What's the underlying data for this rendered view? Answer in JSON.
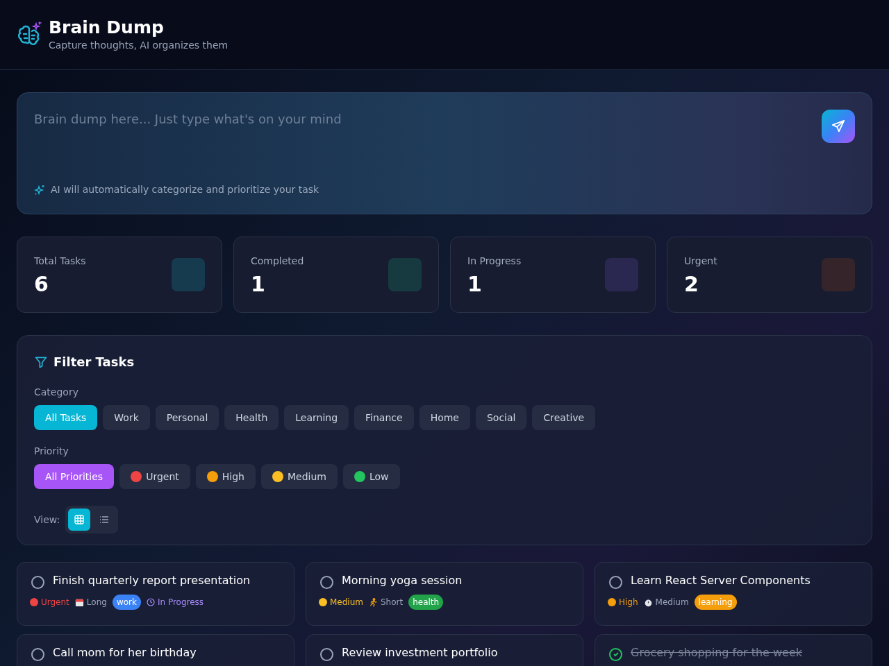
{
  "header": {
    "title": "Brain Dump",
    "subtitle": "Capture thoughts, AI organizes them"
  },
  "input": {
    "placeholder": "Brain dump here... Just type what's on your mind",
    "hint": "AI will automatically categorize and prioritize your task"
  },
  "stats": [
    {
      "label": "Total Tasks",
      "value": "6",
      "color": "#163a4e"
    },
    {
      "label": "Completed",
      "value": "1",
      "color": "#173a40"
    },
    {
      "label": "In Progress",
      "value": "1",
      "color": "#2a2850"
    },
    {
      "label": "Urgent",
      "value": "2",
      "color": "#35252a"
    }
  ],
  "filter": {
    "title": "Filter Tasks",
    "category_label": "Category",
    "categories": [
      {
        "label": "All Tasks",
        "selected": true
      },
      {
        "label": "Work",
        "selected": false
      },
      {
        "label": "Personal",
        "selected": false
      },
      {
        "label": "Health",
        "selected": false
      },
      {
        "label": "Learning",
        "selected": false
      },
      {
        "label": "Finance",
        "selected": false
      },
      {
        "label": "Home",
        "selected": false
      },
      {
        "label": "Social",
        "selected": false
      },
      {
        "label": "Creative",
        "selected": false
      }
    ],
    "priority_label": "Priority",
    "priorities": [
      {
        "label": "All Priorities",
        "selected": true
      },
      {
        "label": "Urgent",
        "selected": false,
        "color": "#ef4444"
      },
      {
        "label": "High",
        "selected": false,
        "color": "#f59e0b"
      },
      {
        "label": "Medium",
        "selected": false,
        "color": "#fbbf24"
      },
      {
        "label": "Low",
        "selected": false,
        "color": "#22c55e"
      }
    ],
    "view_label": "View:",
    "views": [
      {
        "kind": "grid",
        "selected": true
      },
      {
        "kind": "list",
        "selected": false
      }
    ]
  },
  "tasks": [
    {
      "title": "Finish quarterly report presentation",
      "completed": false,
      "priority": {
        "label": "Urgent",
        "color": "#ef4444"
      },
      "duration": {
        "label": "Long",
        "kind": "calendar"
      },
      "tag": {
        "label": "work",
        "color": "#3b82f6"
      },
      "status": "In Progress"
    },
    {
      "title": "Morning yoga session",
      "completed": false,
      "priority": {
        "label": "Medium",
        "color": "#fbbf24"
      },
      "duration": {
        "label": "Short",
        "kind": "runner"
      },
      "tag": {
        "label": "health",
        "color": "#22a34a"
      }
    },
    {
      "title": "Learn React Server Components",
      "completed": false,
      "priority": {
        "label": "High",
        "color": "#f59e0b"
      },
      "duration": {
        "label": "Medium",
        "kind": "stopwatch"
      },
      "tag": {
        "label": "learning",
        "color": "#f59e0b"
      }
    },
    {
      "title": "Call mom for her birthday",
      "completed": false
    },
    {
      "title": "Review investment portfolio",
      "completed": false
    },
    {
      "title": "Grocery shopping for the week",
      "completed": true
    }
  ]
}
